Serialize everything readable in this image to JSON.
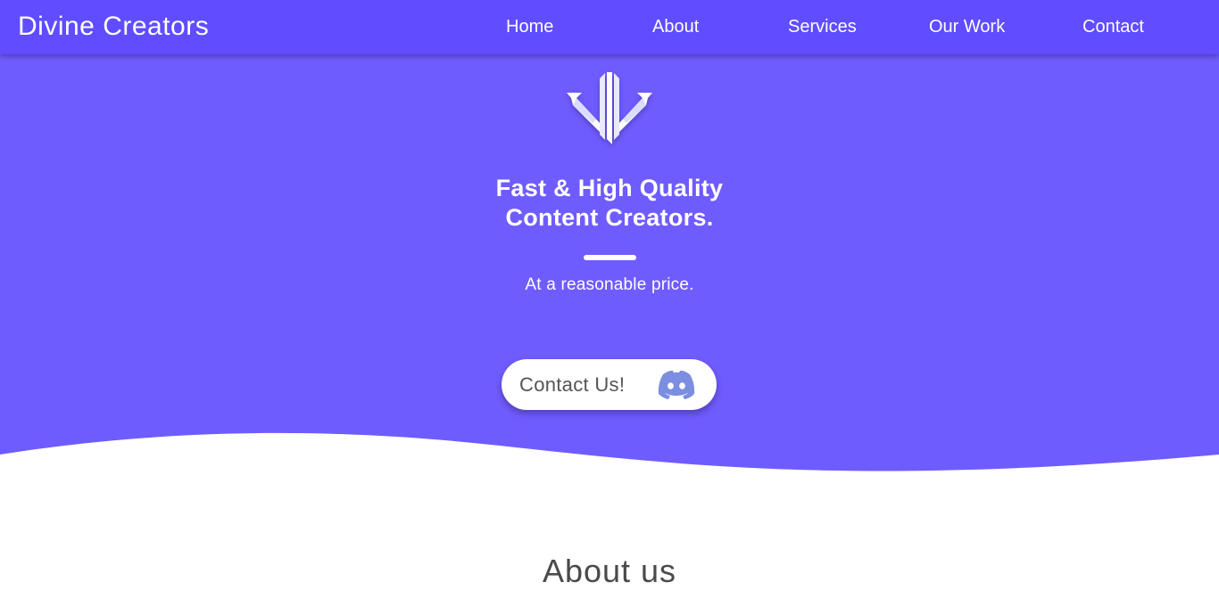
{
  "nav": {
    "brand": "Divine Creators",
    "links": [
      {
        "label": "Home"
      },
      {
        "label": "About"
      },
      {
        "label": "Services"
      },
      {
        "label": "Our Work"
      },
      {
        "label": "Contact"
      }
    ]
  },
  "hero": {
    "headline_line1": "Fast & High Quality",
    "headline_line2": "Content Creators.",
    "subtitle": "At a reasonable price.",
    "cta_label": "Contact Us!",
    "cta_icon": "discord-icon"
  },
  "about": {
    "title": "About us"
  },
  "colors": {
    "navbar": "#5f4dff",
    "hero": "#6f5cff",
    "discord": "#7289da",
    "text_dark": "#4a4a4a"
  }
}
